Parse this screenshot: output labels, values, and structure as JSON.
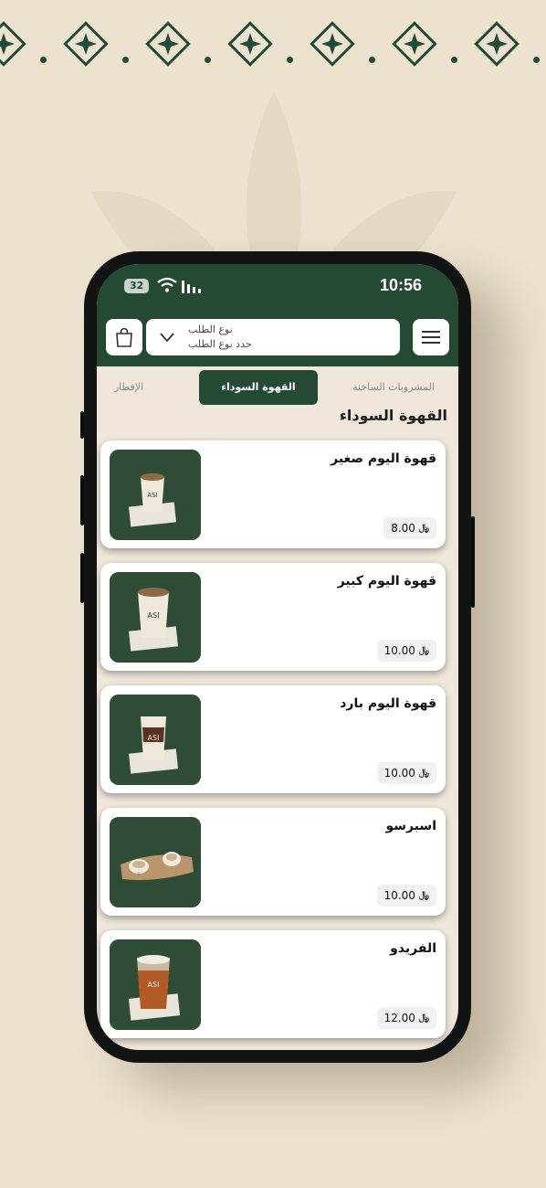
{
  "status_bar": {
    "time": "10:56",
    "battery": "32"
  },
  "header": {
    "order_type_title": "نوع الطلب",
    "order_type_placeholder": "حدد نوع الطلب"
  },
  "tabs": [
    {
      "label": "المشروبات الساخنة",
      "active": false
    },
    {
      "label": "القهوة السوداء",
      "active": true
    },
    {
      "label": "الإفطار",
      "active": false
    }
  ],
  "section_title": "القهوة السوداء",
  "currency_symbol": "﷼",
  "products": [
    {
      "name": "قهوة اليوم صغير",
      "price": "8.00"
    },
    {
      "name": "قهوة اليوم كبير",
      "price": "10.00"
    },
    {
      "name": "قهوة اليوم بارد",
      "price": "10.00"
    },
    {
      "name": "اسبرسو",
      "price": "10.00"
    },
    {
      "name": "الفريدو",
      "price": "12.00"
    }
  ],
  "cup_brand": "ASI",
  "colors": {
    "brand_green": "#244a35",
    "background": "#ede2cf"
  }
}
